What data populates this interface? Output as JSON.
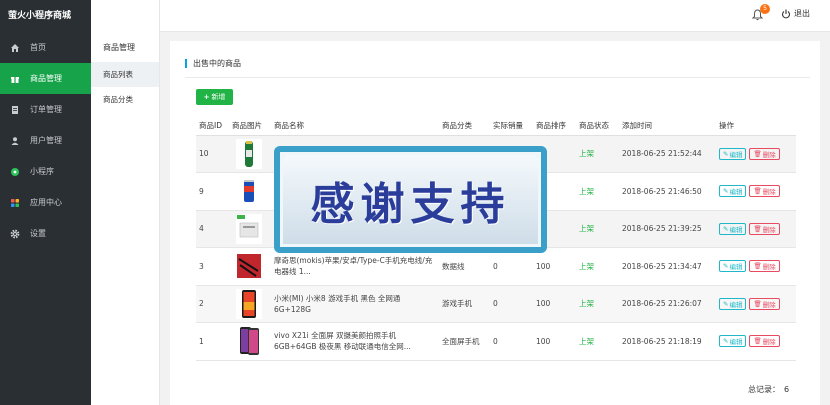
{
  "app": {
    "brand": "萤火小程序商城"
  },
  "sidebar": {
    "items": [
      {
        "label": "首页",
        "icon": "home-icon"
      },
      {
        "label": "商品管理",
        "icon": "gift-icon",
        "active": true
      },
      {
        "label": "订单管理",
        "icon": "order-icon"
      },
      {
        "label": "用户管理",
        "icon": "user-icon"
      },
      {
        "label": "小程序",
        "icon": "miniprogram-icon"
      },
      {
        "label": "应用中心",
        "icon": "apps-icon"
      },
      {
        "label": "设置",
        "icon": "gear-icon"
      }
    ]
  },
  "subnav": {
    "title": "商品管理",
    "items": [
      {
        "label": "商品列表",
        "active": true
      },
      {
        "label": "商品分类"
      }
    ]
  },
  "topbar": {
    "notification_count": "5",
    "logout_label": "退出"
  },
  "panel": {
    "title": "出售中的商品",
    "add_label": "新增"
  },
  "table": {
    "headers": [
      "商品ID",
      "商品图片",
      "商品名称",
      "商品分类",
      "实际销量",
      "商品排序",
      "商品状态",
      "添加时间",
      "操作"
    ],
    "rows": [
      {
        "id": "10",
        "name": "",
        "category": "",
        "sales": "",
        "sort": "",
        "status": "上架",
        "time": "2018-06-25 21:52:44"
      },
      {
        "id": "9",
        "name": "",
        "category": "",
        "sales": "",
        "sort": "",
        "status": "上架",
        "time": "2018-06-25 21:46:50"
      },
      {
        "id": "4",
        "name": "",
        "category": "",
        "sales": "",
        "sort": "",
        "status": "上架",
        "time": "2018-06-25 21:39:25"
      },
      {
        "id": "3",
        "name": "摩奇思(mokis)苹果/安卓/Type-C手机充电线/充电器线 1...",
        "category": "数据线",
        "sales": "0",
        "sort": "100",
        "status": "上架",
        "time": "2018-06-25 21:34:47"
      },
      {
        "id": "2",
        "name": "小米(MI) 小米8 游戏手机 黑色 全网通 6G+128G",
        "category": "游戏手机",
        "sales": "0",
        "sort": "100",
        "status": "上架",
        "time": "2018-06-25 21:26:07"
      },
      {
        "id": "1",
        "name": "vivo X21i 全面屏 双摄美颜拍照手机 6GB+64GB 极夜黑 移动联通电信全网...",
        "category": "全面屏手机",
        "sales": "0",
        "sort": "100",
        "status": "上架",
        "time": "2018-06-25 21:18:19"
      }
    ],
    "edit_label": "编辑",
    "delete_label": "删除"
  },
  "footer": {
    "total_label": "总记录：",
    "total_value": "6"
  },
  "overlay": {
    "text": "感谢支持"
  },
  "colors": {
    "accent": "#16a34a",
    "sidebar_bg": "#2a2f33",
    "edit": "#20b8c8",
    "delete": "#e84a5f"
  }
}
